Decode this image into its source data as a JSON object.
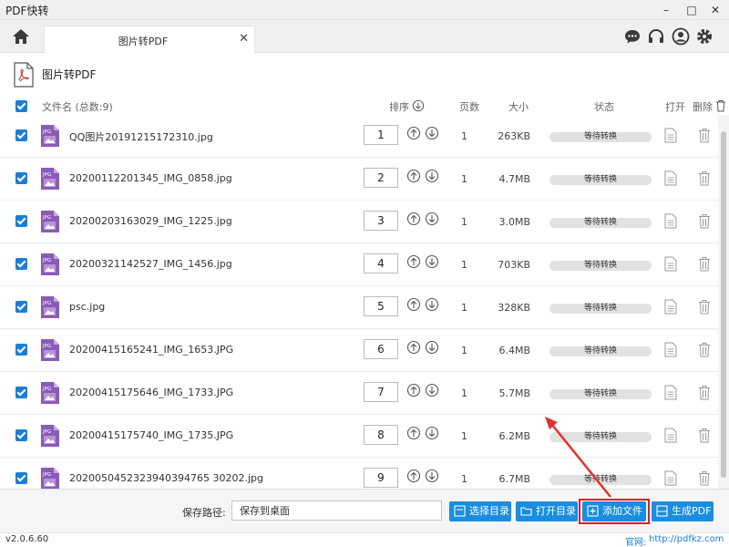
{
  "app": {
    "title": "PDF快转",
    "version": "v2.0.6.60",
    "site_label": "官网:",
    "site": "http://pdfkz.com"
  },
  "window": {
    "minimize": "–",
    "maximize": "□",
    "close": "✕"
  },
  "tab": {
    "label": "图片转PDF",
    "close": "✕"
  },
  "header": {
    "title": "图片转PDF"
  },
  "columns": {
    "filename": "文件名 (总数:9)",
    "order": "排序",
    "pages": "页数",
    "size": "大小",
    "status": "状态",
    "open": "打开",
    "delete": "删除"
  },
  "rows": [
    {
      "name": "QQ图片20191215172310.jpg",
      "order": "1",
      "pages": "1",
      "size": "263KB",
      "status": "等待转换"
    },
    {
      "name": "20200112201345_IMG_0858.jpg",
      "order": "2",
      "pages": "1",
      "size": "4.7MB",
      "status": "等待转换"
    },
    {
      "name": "20200203163029_IMG_1225.jpg",
      "order": "3",
      "pages": "1",
      "size": "3.0MB",
      "status": "等待转换"
    },
    {
      "name": "20200321142527_IMG_1456.jpg",
      "order": "4",
      "pages": "1",
      "size": "703KB",
      "status": "等待转换"
    },
    {
      "name": "psc.jpg",
      "order": "5",
      "pages": "1",
      "size": "328KB",
      "status": "等待转换"
    },
    {
      "name": "20200415165241_IMG_1653.JPG",
      "order": "6",
      "pages": "1",
      "size": "6.4MB",
      "status": "等待转换"
    },
    {
      "name": "20200415175646_IMG_1733.JPG",
      "order": "7",
      "pages": "1",
      "size": "5.7MB",
      "status": "等待转换"
    },
    {
      "name": "20200415175740_IMG_1735.JPG",
      "order": "8",
      "pages": "1",
      "size": "6.2MB",
      "status": "等待转换"
    },
    {
      "name": "2020050452323940394765 30202.jpg",
      "order": "9",
      "pages": "1",
      "size": "6.7MB",
      "status": "等待转换"
    }
  ],
  "footer": {
    "path_label": "保存路径:",
    "path_value": "保存到桌面",
    "select_dir": "选择目录",
    "open_dir": "打开目录",
    "add_file": "添加文件",
    "generate_pdf": "生成PDF"
  },
  "colors": {
    "accent": "#1a8de0",
    "checkbox": "#1a7ed9",
    "highlight": "#e02020",
    "file_icon": "#8b5bb8"
  }
}
